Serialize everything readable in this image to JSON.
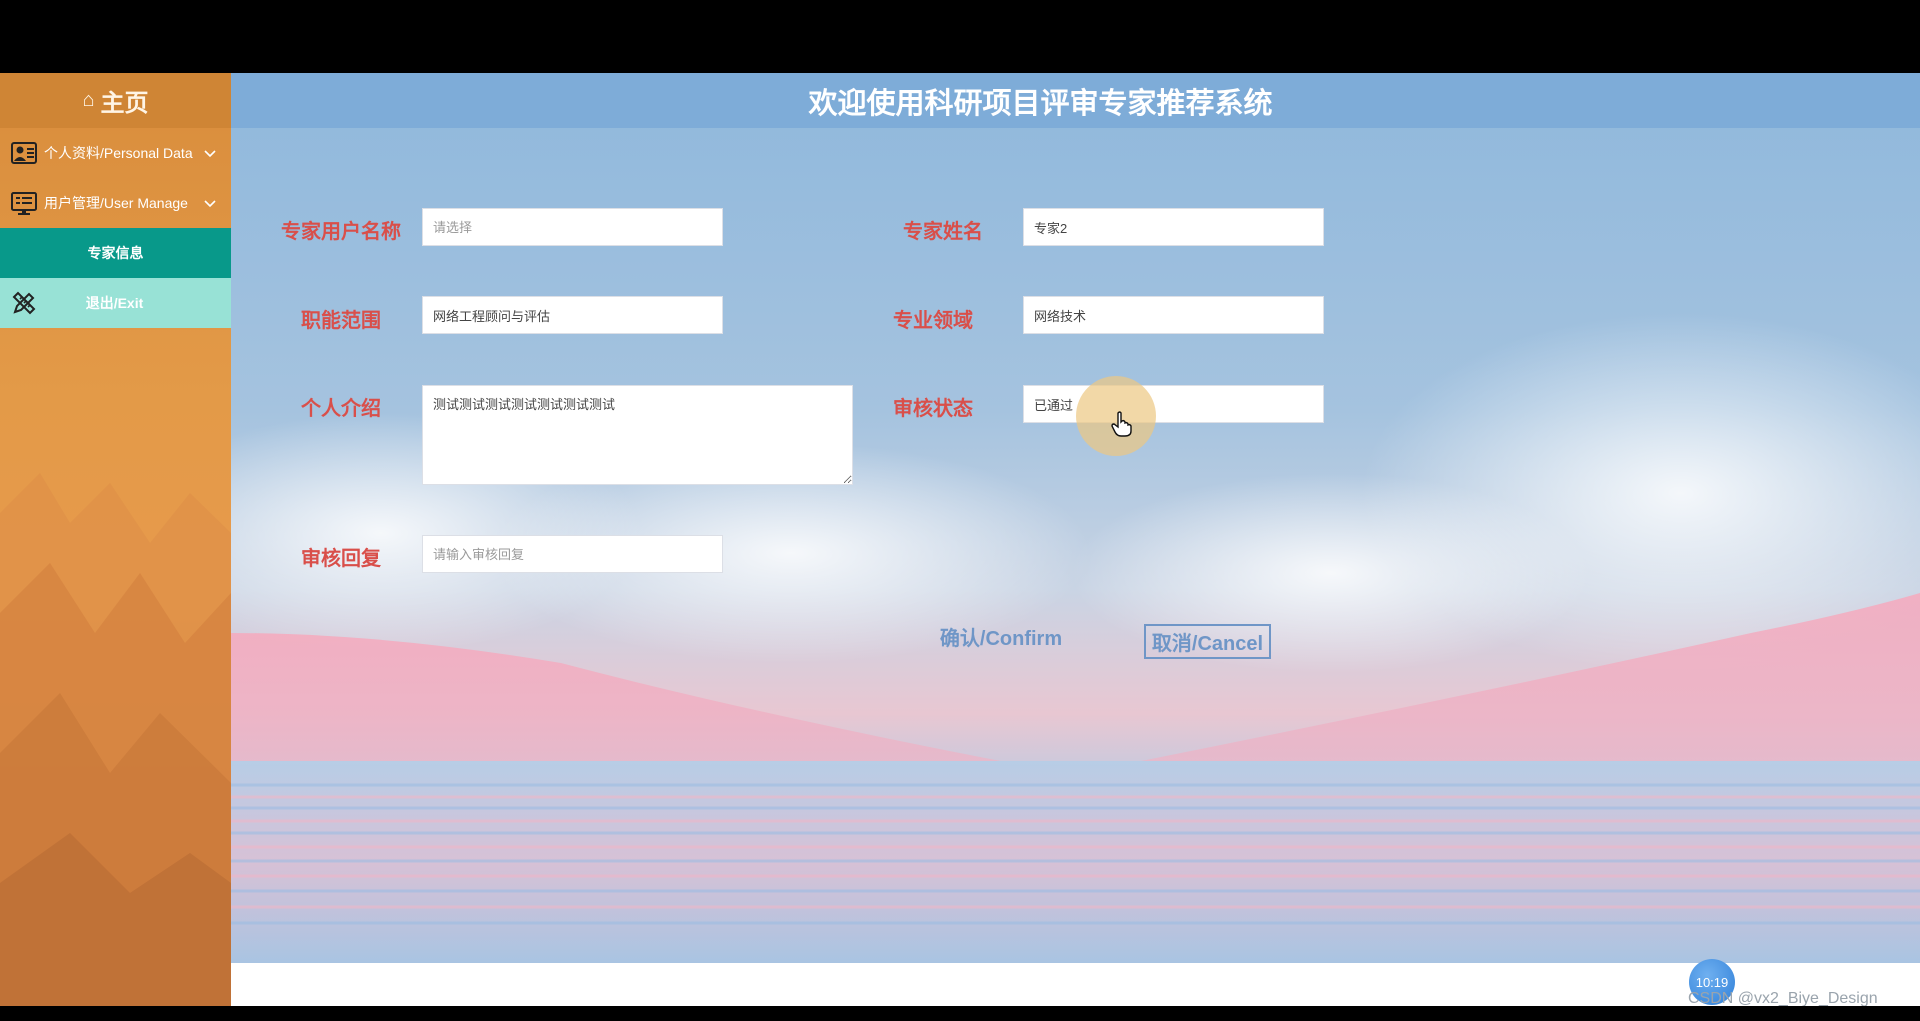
{
  "header": {
    "title": "欢迎使用科研项目评审专家推荐系统"
  },
  "sidebar": {
    "home": {
      "label": "主页",
      "icon": "home-icon"
    },
    "items": [
      {
        "label": "个人资料/Personal Data",
        "icon": "user-card-icon"
      },
      {
        "label": "用户管理/User Manage",
        "icon": "monitor-list-icon"
      },
      {
        "label": "专家信息"
      },
      {
        "label": "退出/Exit",
        "icon": "pencil-ruler-icon"
      }
    ]
  },
  "form": {
    "username": {
      "label": "专家用户名称",
      "placeholder": "请选择",
      "value": ""
    },
    "name": {
      "label": "专家姓名",
      "value": "专家2"
    },
    "scope": {
      "label": "职能范围",
      "value": "网络工程顾问与评估"
    },
    "field": {
      "label": "专业领域",
      "value": "网络技术"
    },
    "intro": {
      "label": "个人介绍",
      "value": "测试测试测试测试测试测试测试"
    },
    "status": {
      "label": "审核状态",
      "value": "已通过"
    },
    "reply": {
      "label": "审核回复",
      "placeholder": "请输入审核回复",
      "value": ""
    }
  },
  "buttons": {
    "confirm": "确认/Confirm",
    "cancel": "取消/Cancel"
  },
  "overlay": {
    "clock": "10:19",
    "watermark": "CSDN @vx2_Biye_Design"
  },
  "colors": {
    "sidebar_active": "#08998a",
    "sidebar_exit": "#98e2d6",
    "label": "#d94f4a",
    "header": "#7eacd8",
    "button": "#6f96c7"
  }
}
